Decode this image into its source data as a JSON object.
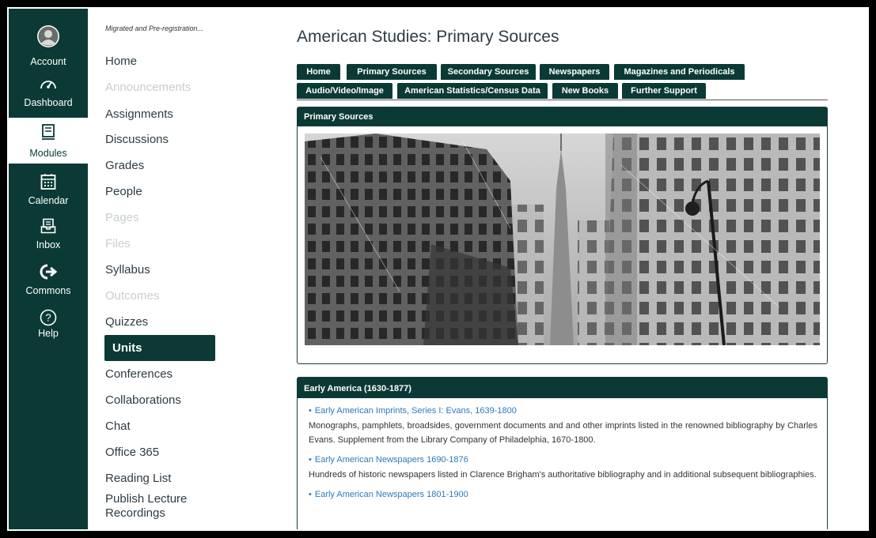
{
  "global_nav": {
    "account": "Account",
    "dashboard": "Dashboard",
    "modules": "Modules",
    "calendar": "Calendar",
    "inbox": "Inbox",
    "commons": "Commons",
    "help": "Help"
  },
  "course_nav": {
    "breadcrumb": "Migrated and Pre-registration...",
    "items": [
      {
        "label": "Home",
        "disabled": false
      },
      {
        "label": "Announcements",
        "disabled": true
      },
      {
        "label": "Assignments",
        "disabled": false
      },
      {
        "label": "Discussions",
        "disabled": false
      },
      {
        "label": "Grades",
        "disabled": false
      },
      {
        "label": "People",
        "disabled": false
      },
      {
        "label": "Pages",
        "disabled": true
      },
      {
        "label": "Files",
        "disabled": true
      },
      {
        "label": "Syllabus",
        "disabled": false
      },
      {
        "label": "Outcomes",
        "disabled": true
      },
      {
        "label": "Quizzes",
        "disabled": false
      },
      {
        "label": "Units",
        "active": true
      },
      {
        "label": "Conferences",
        "disabled": false
      },
      {
        "label": "Collaborations",
        "disabled": false
      },
      {
        "label": "Chat",
        "disabled": false
      },
      {
        "label": "Office 365",
        "disabled": false
      },
      {
        "label": "Reading List",
        "disabled": false
      },
      {
        "label": "Publish Lecture Recordings",
        "disabled": false
      }
    ]
  },
  "page": {
    "title": "American Studies: Primary Sources"
  },
  "tabs": {
    "row1": [
      "Home",
      "Primary Sources",
      "Secondary Sources",
      "Newspapers",
      "Magazines and Periodicals"
    ],
    "row2": [
      "Audio/Video/Image",
      "American Statistics/Census Data",
      "New Books",
      "Further Support"
    ]
  },
  "primary_panel": {
    "heading": "Primary Sources"
  },
  "early_america": {
    "heading": "Early America (1630-1877)",
    "resources": [
      {
        "link": "Early American Imprints, Series I: Evans, 1639-1800",
        "desc": "Monographs, pamphlets, broadsides, government documents and and other imprints listed in the renowned bibliography by Charles Evans. Supplement from the Library Company of Philadelphia, 1670-1800."
      },
      {
        "link": "Early American Newspapers 1690-1876",
        "desc": "Hundreds of historic newspapers listed in Clarence Brigham's authoritative bibliography and in additional subsequent bibliographies."
      },
      {
        "link": "Early American Newspapers 1801-1900",
        "desc": ""
      }
    ]
  },
  "colors": {
    "brand": "#0b3a36",
    "link": "#2b7abc"
  }
}
